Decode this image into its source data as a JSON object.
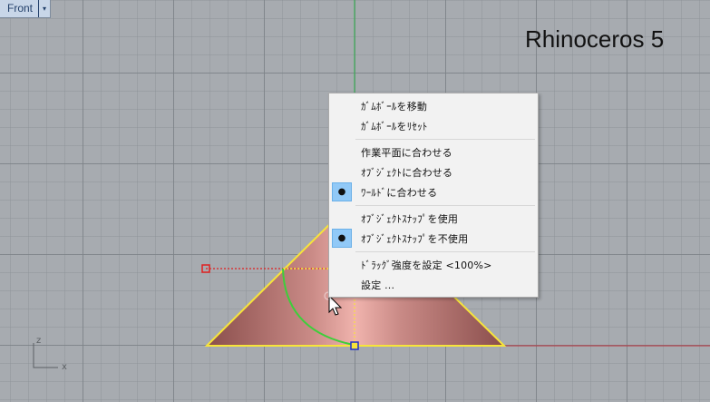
{
  "viewport": {
    "tab_label": "Front",
    "tab_arrow": "▾",
    "watermark": "Rhinoceros 5",
    "axis_z": "z",
    "axis_x": "x"
  },
  "context_menu": {
    "items": [
      {
        "label": "ｶﾞﾑﾎﾞｰﾙを移動",
        "checked": false
      },
      {
        "label": "ｶﾞﾑﾎﾞｰﾙをﾘｾｯﾄ",
        "checked": false
      },
      {
        "label": "作業平面に合わせる",
        "checked": false
      },
      {
        "label": "ｵﾌﾞｼﾞｪｸﾄに合わせる",
        "checked": false
      },
      {
        "label": "ﾜｰﾙﾄﾞに合わせる",
        "checked": true
      },
      {
        "label": "ｵﾌﾞｼﾞｪｸﾄｽﾅｯﾌﾟを使用",
        "checked": false
      },
      {
        "label": "ｵﾌﾞｼﾞｪｸﾄｽﾅｯﾌﾟを不使用",
        "checked": true
      },
      {
        "label": "ﾄﾞﾗｯｸﾞ強度を設定 <100%>",
        "checked": false
      },
      {
        "label": "設定 ...",
        "checked": false
      }
    ],
    "check_glyph": "●"
  },
  "colors": {
    "y_axis": "#2db34a",
    "x_axis": "#b8323b",
    "object_outline": "#f7e43a",
    "cone_fill": "#c4817e",
    "gumball_arc": "#3dcf3a",
    "menu_highlight": "#91c9f7"
  }
}
